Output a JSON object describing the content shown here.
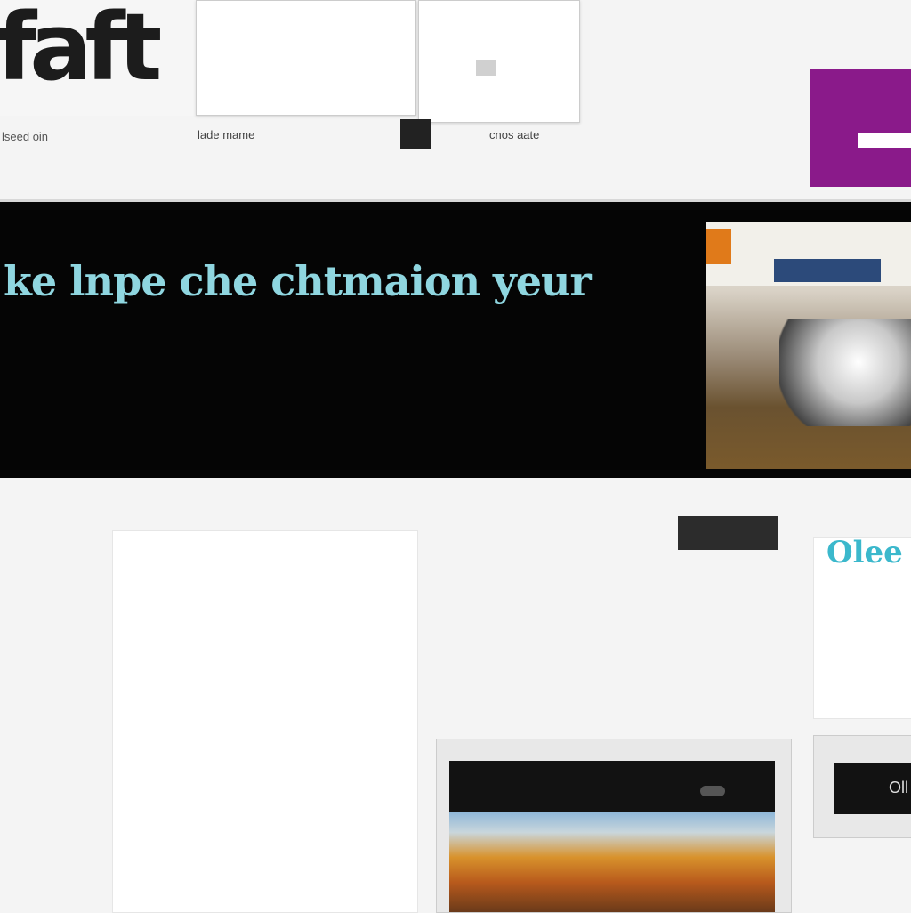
{
  "brand": {
    "logo": "faft",
    "tagline": "lseed oin"
  },
  "top_cards": {
    "card1": {
      "line1": "",
      "line2": ""
    },
    "card2": {
      "line1": ""
    },
    "tags": [
      "lade mame",
      "cnos aate"
    ]
  },
  "hero": {
    "title": "ke lnpe che chtmaion yeur",
    "lines": [],
    "footer_left": "",
    "footer_right": ""
  },
  "content": {
    "dark_button": "",
    "section1_title": "",
    "section2_title": "",
    "section3_title": "",
    "left_col": [],
    "mid_col": [],
    "right_col_title": "Olee",
    "right_col": [],
    "video_bar_text": "",
    "right_video_label": "Oll"
  },
  "colors": {
    "accent": "#3bb8cc",
    "brand": "#8a1a8a",
    "hero_bg": "#050505"
  },
  "icons": {
    "close": "close-icon",
    "record": "record-icon",
    "play": "play-icon"
  }
}
